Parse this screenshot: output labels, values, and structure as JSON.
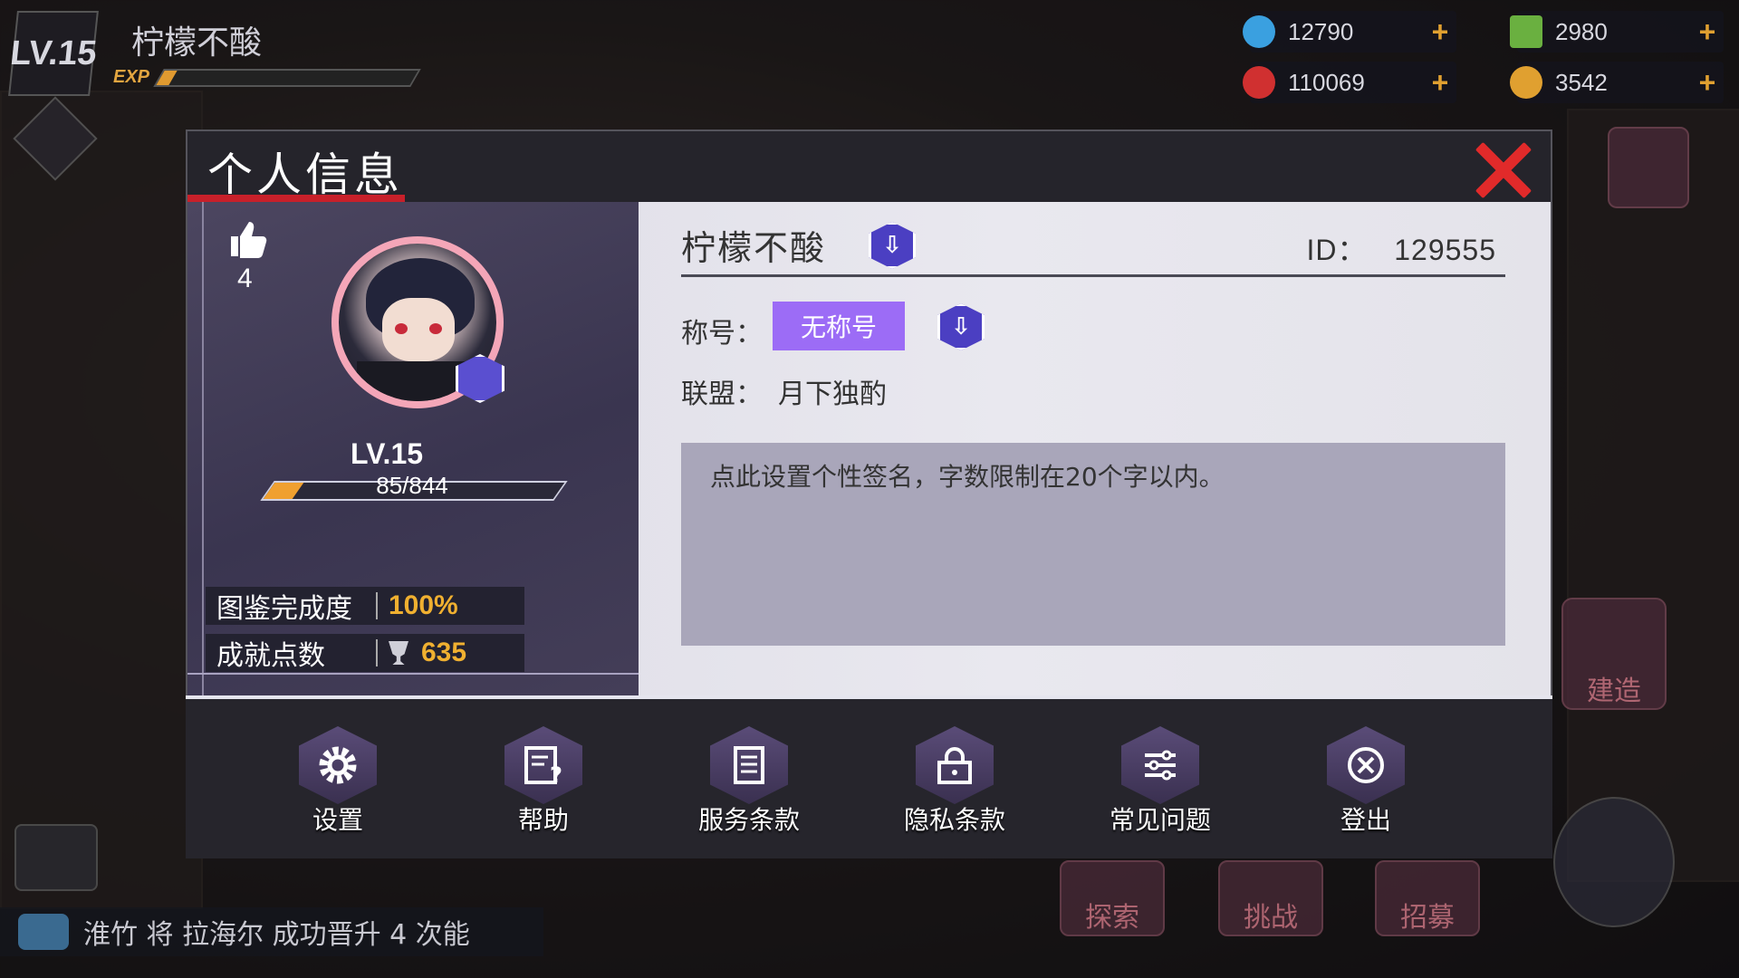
{
  "hud": {
    "level": "LV.15",
    "player_name": "柠檬不酸",
    "exp_label": "EXP",
    "exp_progress": 0.05,
    "resources": [
      {
        "name": "energy",
        "value": "12790",
        "icon": "lightning-icon",
        "color": "#3aa0e0"
      },
      {
        "name": "cubes",
        "value": "2980",
        "icon": "cube-icon",
        "color": "#6ab040"
      },
      {
        "name": "gems",
        "value": "110069",
        "icon": "red-orb-icon",
        "color": "#d03030"
      },
      {
        "name": "gold",
        "value": "3542",
        "icon": "coin-icon",
        "color": "#e0a030"
      }
    ],
    "build_label": "建造",
    "explore_label": "探索",
    "challenge_label": "挑战",
    "recruit_label": "招募",
    "chat_message": "淮竹 将 拉海尔 成功晋升 4 次能"
  },
  "dialog": {
    "title": "个人信息",
    "likes": "4",
    "level": "LV.15",
    "exp_text": "85/844",
    "exp_progress": 0.1,
    "codex_label": "图鉴完成度",
    "codex_value": "100%",
    "achievement_label": "成就点数",
    "achievement_value": "635",
    "name": "柠檬不酸",
    "id_label": "ID：",
    "id_value": "129555",
    "title_label": "称号：",
    "title_value": "无称号",
    "alliance_label": "联盟：",
    "alliance_value": "月下独酌",
    "signature_placeholder": "点此设置个性签名，字数限制在20个字以内。",
    "footer_buttons": [
      {
        "label": "设置",
        "icon": "gear-icon"
      },
      {
        "label": "帮助",
        "icon": "help-icon"
      },
      {
        "label": "服务条款",
        "icon": "document-icon"
      },
      {
        "label": "隐私条款",
        "icon": "lock-icon"
      },
      {
        "label": "常见问题",
        "icon": "list-icon"
      },
      {
        "label": "登出",
        "icon": "logout-icon"
      }
    ]
  }
}
